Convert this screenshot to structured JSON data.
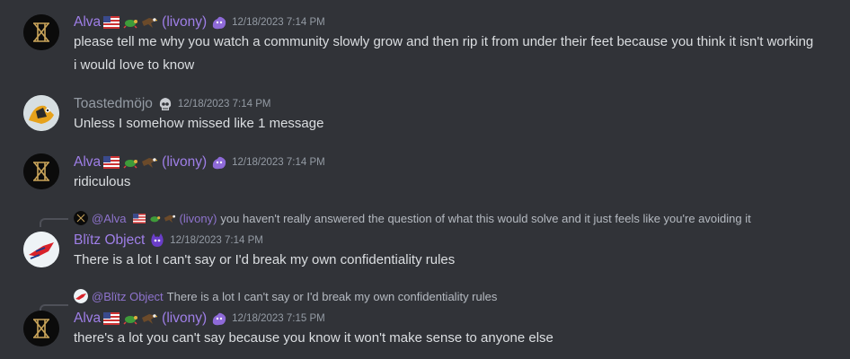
{
  "messages": [
    {
      "author": "Alva",
      "suffix": "(livony)",
      "timestamp": "12/18/2023 7:14 PM",
      "lines": [
        "please tell me why you watch a community slowly grow and then rip it from under their feet because you think it isn't working",
        "i would love to know"
      ]
    },
    {
      "author": "Toastedmöjo",
      "timestamp": "12/18/2023 7:14 PM",
      "lines": [
        "Unless I somehow missed like 1 message"
      ]
    },
    {
      "author": "Alva",
      "suffix": "(livony)",
      "timestamp": "12/18/2023 7:14 PM",
      "lines": [
        "ridiculous"
      ]
    },
    {
      "reply": {
        "author": "@Alva",
        "suffix": "(livony)",
        "text": "you haven't really answered the question of what this would solve and it just feels like you're avoiding it"
      },
      "author": "Blïtz Object",
      "timestamp": "12/18/2023 7:14 PM",
      "lines": [
        "There is a lot I can't say or I'd break my own confidentiality rules"
      ]
    },
    {
      "reply": {
        "author": "@Blïtz Object",
        "text": "There is a lot I can't say or I'd break my own confidentiality rules"
      },
      "author": "Alva",
      "suffix": "(livony)",
      "timestamp": "12/18/2023 7:15 PM",
      "lines": [
        "there's a lot you can't say because you know it won't make sense to anyone else"
      ]
    }
  ],
  "icons": {
    "name_emojis": [
      "us-flag-emoji",
      "turtle-emoji",
      "eagle-emoji"
    ],
    "badges": [
      "purple-blob-badge",
      "skull-badge",
      "purple-horns-badge"
    ]
  },
  "colors": {
    "background": "#313338",
    "role_purple": "#9f7fe8",
    "muted": "#949ba4",
    "text": "#dbdee1"
  }
}
